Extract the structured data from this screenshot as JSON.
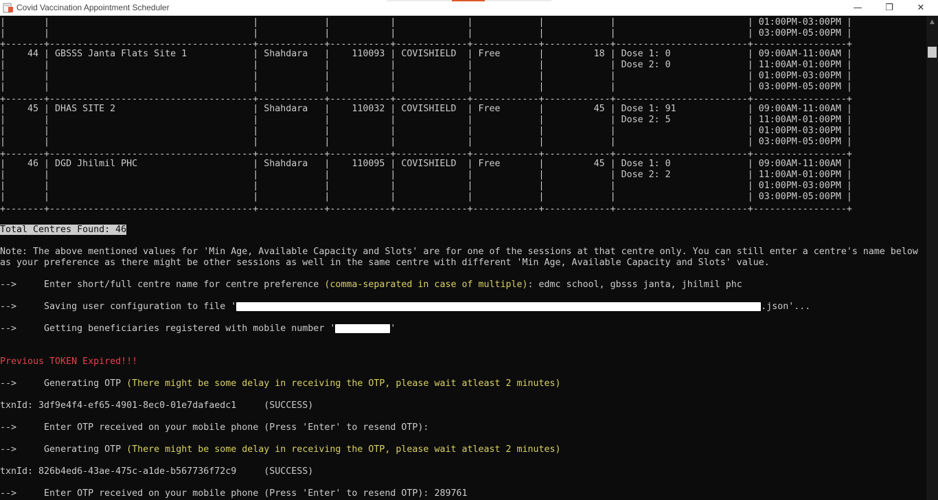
{
  "window": {
    "title": "Covid Vaccination Appointment Scheduler",
    "minimize_glyph": "—",
    "maximize_glyph": "❐",
    "close_glyph": "✕",
    "icon": "notepad-like-app-icon"
  },
  "scrollbar": {
    "up_glyph": "▲"
  },
  "table": {
    "top_partial_rows": [
      "|       |                                     |            |           |             |            |            |                        | 01:00PM-03:00PM |",
      "|       |                                     |            |           |             |            |            |                        | 03:00PM-05:00PM |"
    ],
    "separator": "+-------+-------------------------------------+------------+-----------+-------------+------------+------------+------------------------+-----------------+",
    "rows": [
      {
        "lines": [
          "|    44 | GBSSS Janta Flats Site 1            | Shahdara   |    110093 | COVISHIELD  | Free       |         18 | Dose 1: 0              | 09:00AM-11:00AM |",
          "|       |                                     |            |           |             |            |            | Dose 2: 0              | 11:00AM-01:00PM |",
          "|       |                                     |            |           |             |            |            |                        | 01:00PM-03:00PM |",
          "|       |                                     |            |           |             |            |            |                        | 03:00PM-05:00PM |"
        ]
      },
      {
        "lines": [
          "|    45 | DHAS SITE 2                         | Shahdara   |    110032 | COVISHIELD  | Free       |         45 | Dose 1: 91             | 09:00AM-11:00AM |",
          "|       |                                     |            |           |             |            |            | Dose 2: 5              | 11:00AM-01:00PM |",
          "|       |                                     |            |           |             |            |            |                        | 01:00PM-03:00PM |",
          "|       |                                     |            |           |             |            |            |                        | 03:00PM-05:00PM |"
        ]
      },
      {
        "lines": [
          "|    46 | DGD Jhilmil PHC                     | Shahdara   |    110095 | COVISHIELD  | Free       |         45 | Dose 1: 0              | 09:00AM-11:00AM |",
          "|       |                                     |            |           |             |            |            | Dose 2: 2              | 11:00AM-01:00PM |",
          "|       |                                     |            |           |             |            |            |                        | 01:00PM-03:00PM |",
          "|       |                                     |            |           |             |            |            |                        | 03:00PM-05:00PM |"
        ]
      }
    ]
  },
  "log": {
    "total_centres": "Total Centres Found: 46",
    "note_line1": "Note: The above mentioned values for 'Min Age, Available Capacity and Slots' are for one of the sessions at that centre only. You can still enter a centre's name below",
    "note_line2": "as your preference as there might be other sessions as well in the same centre with different 'Min Age, Available Capacity and Slots' value.",
    "arrow": "-->     ",
    "pref_prefix": "Enter short/full centre name for centre preference ",
    "pref_hint": "(comma-separated in case of multiple)",
    "pref_value": ": edmc school, gbsss janta, jhilmil phc",
    "save_prefix": "Saving user configuration to file '",
    "save_suffix": ".json'...",
    "benef_prefix": "Getting beneficiaries registered with mobile number '",
    "benef_suffix": "'",
    "token_expired": "Previous TOKEN Expired!!!",
    "gen_otp": "Generating OTP ",
    "gen_otp_hint": "(There might be some delay in receiving the OTP, please wait atleast 2 minutes)",
    "txn1": "txnId: 3df9e4f4-ef65-4901-8ec0-01e7dafaedc1     (SUCCESS)",
    "enter_otp": "Enter OTP received on your mobile phone (Press 'Enter' to resend OTP):",
    "txn2": "txnId: 826b4ed6-43ae-475c-a1de-b567736f72c9     (SUCCESS)",
    "enter_otp_value": " 289761"
  }
}
